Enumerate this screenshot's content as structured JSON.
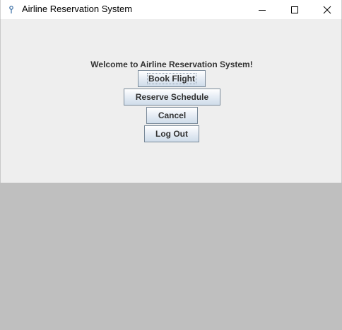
{
  "window": {
    "title": "Airline Reservation System",
    "icon": "java-app-icon",
    "controls": {
      "minimize_icon": "minimize-icon",
      "maximize_icon": "maximize-icon",
      "close_icon": "close-icon"
    }
  },
  "main": {
    "welcome_text": "Welcome to Airline Reservation System!",
    "buttons": {
      "book_flight": "Book Flight",
      "reserve_schedule": "Reserve Schedule",
      "cancel": "Cancel",
      "log_out": "Log Out"
    }
  },
  "colors": {
    "panel_background": "#eeeeee",
    "outer_background": "#bfbfbf",
    "button_border": "#7a8a99",
    "text": "#333333"
  }
}
